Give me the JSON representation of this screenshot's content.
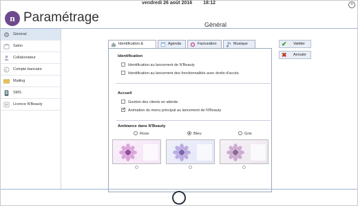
{
  "topbar": {
    "date": "vendredi 26 août 2016",
    "time": "18:12",
    "close_glyph": "×"
  },
  "app": {
    "logo_letter": "n",
    "title": "Paramétrage",
    "section_title": "Général"
  },
  "sidebar": {
    "items": [
      {
        "label": "Général",
        "icon": "gear-icon",
        "active": true
      },
      {
        "label": "Salon",
        "icon": "store-icon",
        "active": false
      },
      {
        "label": "Collaborateur",
        "icon": "user-icon",
        "active": false
      },
      {
        "label": "Compte bancaire",
        "icon": "bank-icon",
        "active": false
      },
      {
        "label": "Mailing",
        "icon": "mail-icon",
        "active": false
      },
      {
        "label": "SMS",
        "icon": "sms-icon",
        "active": false
      },
      {
        "label": "Licence N'Beauty",
        "icon": "license-icon",
        "active": false
      }
    ]
  },
  "tabs": [
    {
      "label": "Identification & Accueil",
      "icon": "home-icon",
      "active": true
    },
    {
      "label": "Agenda",
      "icon": "calendar-icon",
      "active": false
    },
    {
      "label": "Facturation",
      "icon": "invoice-icon",
      "active": false
    },
    {
      "label": "Musique",
      "icon": "music-icon",
      "active": false
    }
  ],
  "identification": {
    "title": "Identification",
    "options": [
      {
        "label": "Identification au lancement de N'Beauty",
        "checked": false
      },
      {
        "label": "Identification au lancement des fonctionnalités avec droits d'accès",
        "checked": false
      }
    ]
  },
  "accueil": {
    "title": "Accueil",
    "options": [
      {
        "label": "Gestion des clients en attente",
        "checked": false
      },
      {
        "label": "Animation du menu principal au lancement de N'Beauty",
        "checked": true
      }
    ]
  },
  "ambiance": {
    "title": "Ambiance dans N'Beauty",
    "themes": [
      {
        "label": "Rose",
        "selected": false,
        "color": "#d79ad6"
      },
      {
        "label": "Bleu",
        "selected": true,
        "color": "#b9a6df"
      },
      {
        "label": "Gris",
        "selected": false,
        "color": "#c9a6cf"
      }
    ]
  },
  "actions": {
    "validate_label": "Valider",
    "cancel_label": "Annuler"
  },
  "colors": {
    "accent": "#6d4a8e",
    "border": "#9fb4d0",
    "validate": "#2a9a2a",
    "cancel": "#c0392b"
  }
}
